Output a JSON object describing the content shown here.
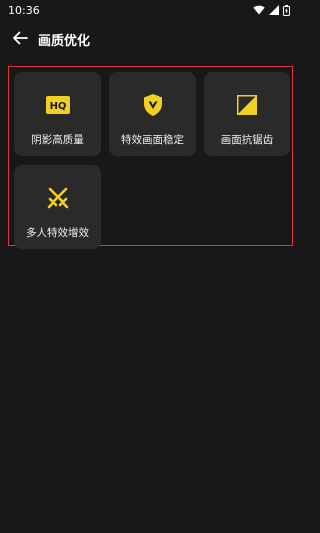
{
  "status_bar": {
    "time": "10:36"
  },
  "header": {
    "title": "画质优化"
  },
  "features": [
    {
      "label": "阴影高质量",
      "icon": "hq-icon",
      "icon_text": "HQ"
    },
    {
      "label": "特效画面稳定",
      "icon": "shield-v-icon"
    },
    {
      "label": "画面抗锯齿",
      "icon": "antialias-corner-icon"
    },
    {
      "label": "多人特效增效",
      "icon": "crossed-swords-icon"
    }
  ],
  "colors": {
    "background": "#181818",
    "tile": "#2a2a2a",
    "accent_yellow": "#f2d023",
    "highlight_red": "#e0333a"
  }
}
